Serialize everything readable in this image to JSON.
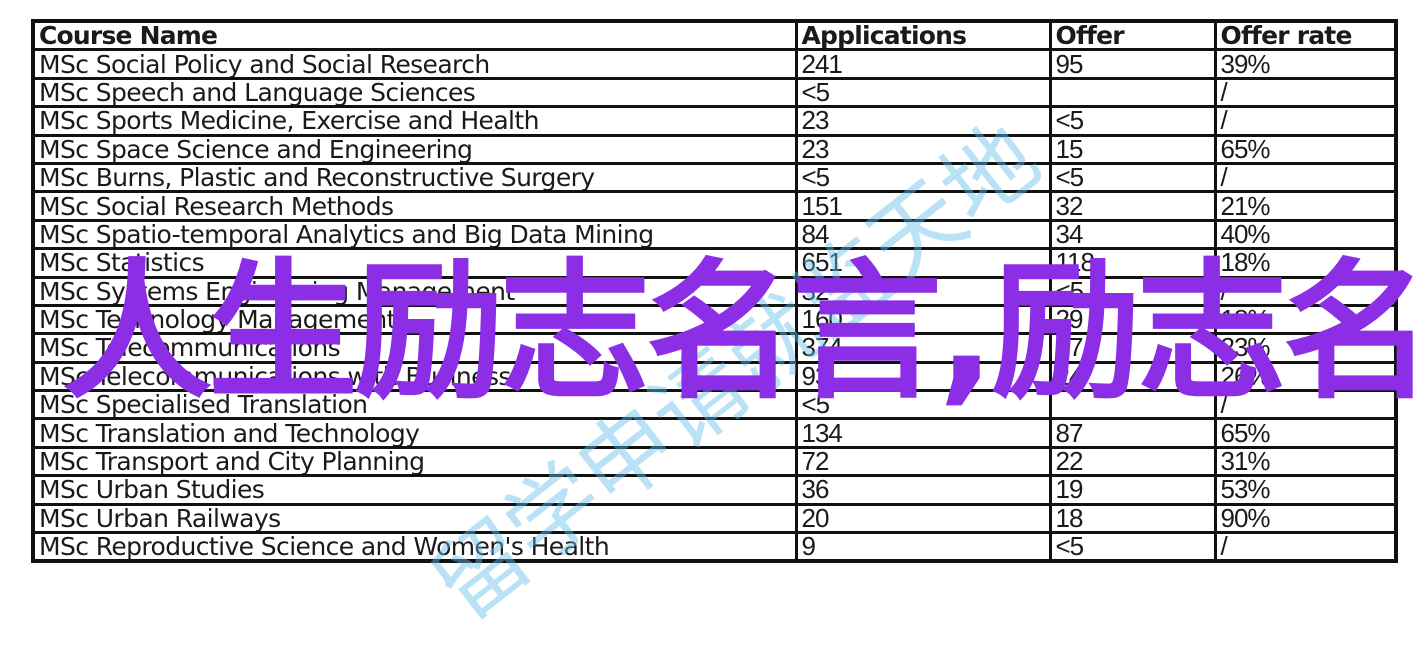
{
  "table": {
    "headers": [
      "Course Name",
      "Applications",
      "Offer",
      "Offer rate"
    ],
    "rows": [
      [
        "MSc Social Policy and Social Research",
        "241",
        "95",
        "39%"
      ],
      [
        "MSc Speech and Language Sciences",
        "<5",
        "",
        "/"
      ],
      [
        "MSc Sports Medicine, Exercise and Health",
        "23",
        "<5",
        "/"
      ],
      [
        "MSc Space Science and Engineering",
        "23",
        "15",
        "65%"
      ],
      [
        "MSc Burns, Plastic and Reconstructive Surgery",
        "<5",
        "<5",
        "/"
      ],
      [
        "MSc Social Research Methods",
        "151",
        "32",
        "21%"
      ],
      [
        "MSc Spatio-temporal Analytics and Big Data Mining",
        "84",
        "34",
        "40%"
      ],
      [
        "MSc Statistics",
        "651",
        "118",
        "18%"
      ],
      [
        "MSc Systems Engineering Management",
        "32",
        "<5",
        "/"
      ],
      [
        "MSc Technology Management",
        "160",
        "29",
        "18%"
      ],
      [
        "MSc Telecommunications",
        "374",
        "87",
        "23%"
      ],
      [
        "MSc Telecommunications with Business",
        "93",
        "24",
        "26%"
      ],
      [
        "MSc Specialised Translation",
        "<5",
        "",
        "/"
      ],
      [
        "MSc Translation and Technology",
        "134",
        "87",
        "65%"
      ],
      [
        "MSc Transport and City Planning",
        "72",
        "22",
        "31%"
      ],
      [
        "MSc Urban Studies",
        "36",
        "19",
        "53%"
      ],
      [
        "MSc Urban Railways",
        "20",
        "18",
        "90%"
      ],
      [
        "MSc Reproductive Science and Women's Health",
        "9",
        "<5",
        "/"
      ]
    ]
  },
  "overlay_text": "人生励志名言,励志名",
  "watermark_text": "留学申请就监天地",
  "colors": {
    "overlay": "#8b2ee6",
    "watermark": "#64bee b",
    "border": "#111111"
  }
}
